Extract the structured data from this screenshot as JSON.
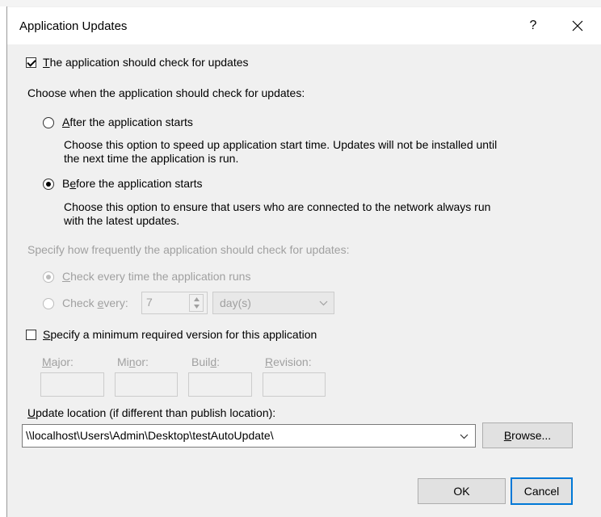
{
  "dialog": {
    "title": "Application Updates",
    "help_label": "?",
    "close_label": "✕"
  },
  "check_updates": {
    "checked": true,
    "label_hotkey": "T",
    "label_rest": "he application should check for updates"
  },
  "when": {
    "heading": "Choose when the application should check for updates:",
    "after": {
      "selected": false,
      "label_hotkey": "A",
      "label_rest": "fter the application starts",
      "desc_line1": "Choose this option to speed up application start time. Updates will not be installed until",
      "desc_line2": "the next time the application is run."
    },
    "before": {
      "selected": true,
      "label_pre": "B",
      "label_hotkey": "e",
      "label_rest": "fore the application starts",
      "desc_line1": "Choose this option to ensure that users who are connected to the network always run",
      "desc_line2": "with the latest updates."
    }
  },
  "frequency": {
    "heading": "Specify how frequently the application should check for updates:",
    "every_run": {
      "selected": true,
      "label_hotkey": "C",
      "label_rest": "heck every time the application runs"
    },
    "every_n": {
      "selected": false,
      "label_pre": "Check ",
      "label_hotkey": "e",
      "label_rest": "very:",
      "value": "7",
      "unit": "day(s)"
    }
  },
  "min_version": {
    "checked": false,
    "label_hotkey": "S",
    "label_rest": "pecify a minimum required version for this application",
    "fields": {
      "major": {
        "pre": "",
        "hotkey": "M",
        "rest": "ajor:"
      },
      "minor": {
        "pre": "Mi",
        "hotkey": "n",
        "rest": "or:"
      },
      "build": {
        "pre": "Buil",
        "hotkey": "d",
        "rest": ":"
      },
      "revision": {
        "pre": "",
        "hotkey": "R",
        "rest": "evision:"
      }
    }
  },
  "location": {
    "label_hotkey": "U",
    "label_rest": "pdate location (if different than publish location):",
    "value": "\\\\localhost\\Users\\Admin\\Desktop\\testAutoUpdate\\",
    "browse_hotkey": "B",
    "browse_rest": "rowse..."
  },
  "buttons": {
    "ok": "OK",
    "cancel": "Cancel"
  },
  "colors": {
    "accent": "#0078d7",
    "dialog_bg": "#f0f0f0",
    "disabled_text": "#a0a0a0"
  },
  "icons": [
    "checkbox-icon",
    "radio-icon",
    "spin-up-icon",
    "spin-down-icon",
    "chevron-down-icon",
    "close-icon"
  ]
}
